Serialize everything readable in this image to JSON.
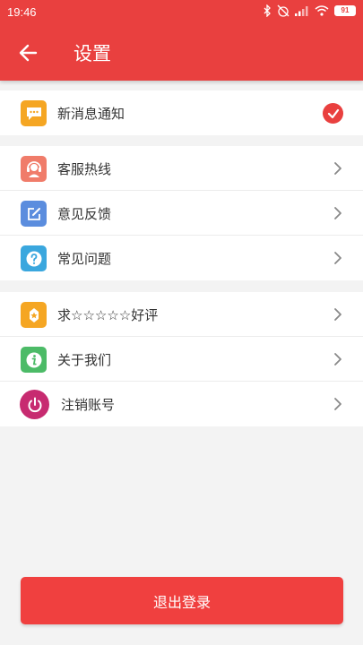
{
  "status_bar": {
    "time": "19:46",
    "battery": "91"
  },
  "header": {
    "title": "设置"
  },
  "groups": [
    {
      "items": [
        {
          "label": "新消息通知",
          "icon": "message-icon",
          "color": "#f5a623",
          "control": "check"
        }
      ]
    },
    {
      "items": [
        {
          "label": "客服热线",
          "icon": "customer-service-icon",
          "color": "#f07c6a",
          "control": "chevron"
        },
        {
          "label": "意见反馈",
          "icon": "feedback-edit-icon",
          "color": "#5b8dde",
          "control": "chevron"
        },
        {
          "label": "常见问题",
          "icon": "question-icon",
          "color": "#3aa7de",
          "control": "chevron"
        }
      ]
    },
    {
      "items": [
        {
          "label": "求☆☆☆☆☆好评",
          "icon": "star-icon",
          "color": "#f5a623",
          "control": "chevron"
        },
        {
          "label": "关于我们",
          "icon": "info-icon",
          "color": "#4cbb67",
          "control": "chevron"
        },
        {
          "label": "注销账号",
          "icon": "power-icon",
          "color": "#c72b70",
          "control": "chevron"
        }
      ]
    }
  ],
  "logout_button": {
    "label": "退出登录"
  },
  "colors": {
    "accent": "#e9403f"
  }
}
